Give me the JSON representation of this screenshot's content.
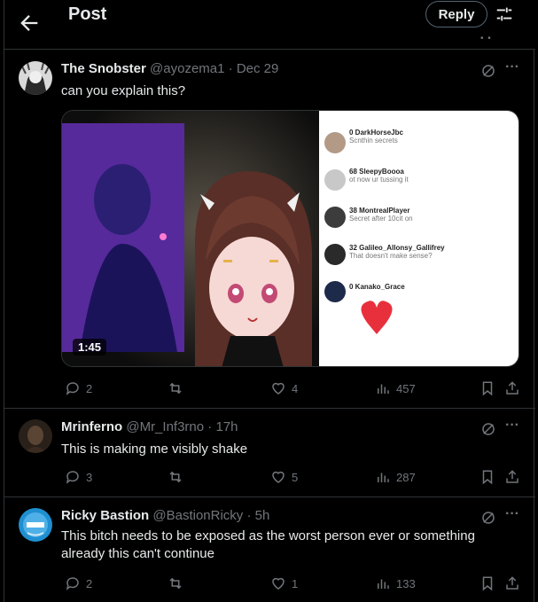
{
  "header": {
    "title": "Post",
    "reply_label": "Reply"
  },
  "posts": [
    {
      "name": "The Snobster",
      "handle": "@ayozema1",
      "time": "Dec 29",
      "text": "can you explain this?",
      "video_duration": "1:45",
      "replies": "2",
      "reposts": "",
      "likes": "4",
      "views": "457",
      "chat": [
        {
          "name": "0 DarkHorseJbc",
          "sub": "Scnthin secrets"
        },
        {
          "name": "68 SleepyBoooa",
          "sub": "ot now ur tussing it"
        },
        {
          "name": "38 MontrealPlayer",
          "sub": "Secret after 10cit on"
        },
        {
          "name": "32 Galileo_Allonsy_Gallifrey",
          "sub": "That doesn't make sense?"
        },
        {
          "name": "0 Kanako_Grace",
          "sub": ""
        }
      ]
    },
    {
      "name": "Mrinferno",
      "handle": "@Mr_Inf3rno",
      "time": "17h",
      "text": "This is making me visibly shake",
      "replies": "3",
      "reposts": "",
      "likes": "5",
      "views": "287"
    },
    {
      "name": "Ricky Bastion",
      "handle": "@BastionRicky",
      "time": "5h",
      "text": "This bitch needs to be exposed as the worst person ever or something already this can't continue",
      "replies": "2",
      "reposts": "",
      "likes": "1",
      "views": "133"
    }
  ],
  "colors": {
    "background": "#000000",
    "text": "#e7e9ea",
    "muted": "#71767b",
    "border": "#2f3336"
  },
  "icons": [
    "back-arrow-icon",
    "filter-icon",
    "grok-icon",
    "more-icon",
    "reply-icon",
    "repost-icon",
    "like-icon",
    "views-icon",
    "bookmark-icon",
    "share-icon"
  ]
}
